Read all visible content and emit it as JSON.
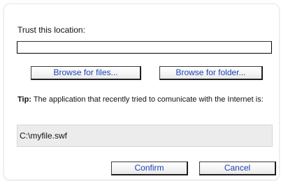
{
  "dialog": {
    "trust_label": "Trust this location:",
    "location_value": "",
    "browse_files_label": "Browse for files...",
    "browse_folder_label": "Browse for folder...",
    "tip_prefix": "Tip:",
    "tip_text": " The application that recently tried to comunicate with the Internet is:",
    "app_path": "C:\\myfile.swf",
    "confirm_label": "Confirm",
    "cancel_label": "Cancel"
  },
  "colors": {
    "button_text": "#1a3fb4",
    "path_box_bg": "#ececec"
  }
}
